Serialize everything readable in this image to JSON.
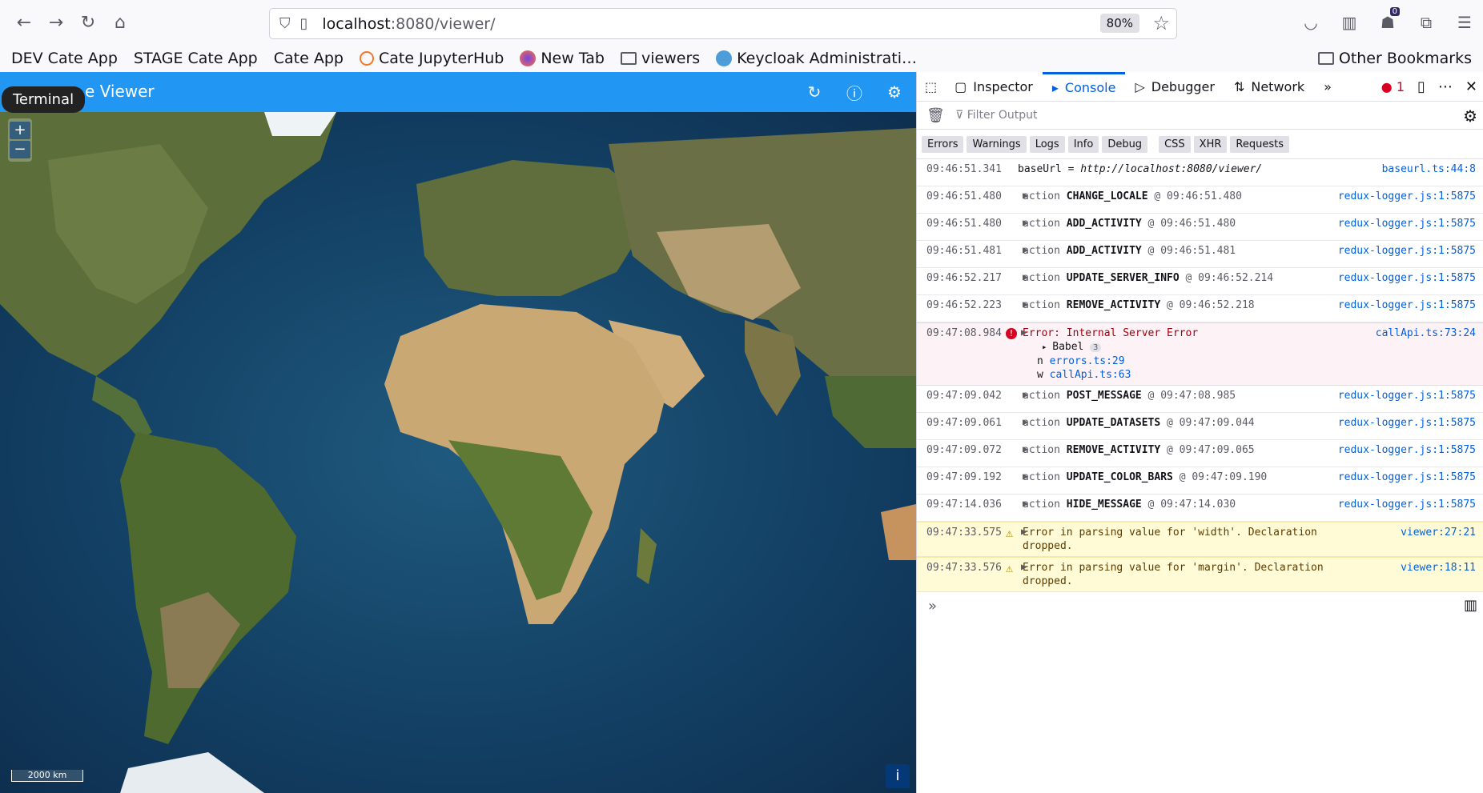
{
  "browser": {
    "url_host": "localhost",
    "url_rest": ":8080/viewer/",
    "zoom": "80%",
    "notification_count": "0"
  },
  "bookmarks": [
    {
      "label": "DEV Cate App",
      "icon": "app-icon"
    },
    {
      "label": "STAGE Cate App",
      "icon": "app-icon"
    },
    {
      "label": "Cate App",
      "icon": "app-icon"
    },
    {
      "label": "Cate JupyterHub",
      "icon": "jupyter-icon"
    },
    {
      "label": "New Tab",
      "icon": "firefox-icon"
    },
    {
      "label": "viewers",
      "icon": "folder-icon"
    },
    {
      "label": "Keycloak Administrati…",
      "icon": "keycloak-icon"
    }
  ],
  "other_bookmarks": "Other Bookmarks",
  "app": {
    "title": "e Viewer",
    "tooltip": "Terminal",
    "zoom_in": "+",
    "zoom_out": "−",
    "scale_label": "2000 km",
    "info": "i"
  },
  "devtools": {
    "tabs": [
      "Inspector",
      "Console",
      "Debugger",
      "Network"
    ],
    "error_count": "1",
    "filter_placeholder": "Filter Output",
    "levels": [
      "Errors",
      "Warnings",
      "Logs",
      "Info",
      "Debug"
    ],
    "net_levels": [
      "CSS",
      "XHR",
      "Requests"
    ],
    "logs": [
      {
        "type": "plain",
        "ts": "09:46:51.341",
        "label": "baseUrl = ",
        "value": "http://localhost:8080/viewer/",
        "src": "baseurl.ts:44:8"
      },
      {
        "type": "action",
        "ts": "09:46:51.480",
        "name": "CHANGE_LOCALE",
        "at": "@ 09:46:51.480",
        "src": "redux-logger.js:1:5875"
      },
      {
        "type": "action",
        "ts": "09:46:51.480",
        "name": "ADD_ACTIVITY",
        "at": "@ 09:46:51.480",
        "src": "redux-logger.js:1:5875"
      },
      {
        "type": "action",
        "ts": "09:46:51.481",
        "name": "ADD_ACTIVITY",
        "at": "@ 09:46:51.481",
        "src": "redux-logger.js:1:5875"
      },
      {
        "type": "action",
        "ts": "09:46:52.217",
        "name": "UPDATE_SERVER_INFO",
        "at": "@ 09:46:52.214",
        "src": "redux-logger.js:1:5875"
      },
      {
        "type": "action",
        "ts": "09:46:52.223",
        "name": "REMOVE_ACTIVITY",
        "at": "@ 09:46:52.218",
        "src": "redux-logger.js:1:5875"
      },
      {
        "type": "error",
        "ts": "09:47:08.984",
        "msg": "Error: Internal Server Error",
        "src": "callApi.ts:73:24",
        "sub": [
          {
            "pre": "Babel",
            "count": "3"
          },
          {
            "pre": "n",
            "link": "errors.ts:29"
          },
          {
            "pre": "w",
            "link": "callApi.ts:63"
          }
        ]
      },
      {
        "type": "action",
        "ts": "09:47:09.042",
        "name": "POST_MESSAGE",
        "at": "@ 09:47:08.985",
        "src": "redux-logger.js:1:5875"
      },
      {
        "type": "action",
        "ts": "09:47:09.061",
        "name": "UPDATE_DATASETS",
        "at": "@ 09:47:09.044",
        "src": "redux-logger.js:1:5875"
      },
      {
        "type": "action",
        "ts": "09:47:09.072",
        "name": "REMOVE_ACTIVITY",
        "at": "@ 09:47:09.065",
        "src": "redux-logger.js:1:5875"
      },
      {
        "type": "action",
        "ts": "09:47:09.192",
        "name": "UPDATE_COLOR_BARS",
        "at": "@ 09:47:09.190",
        "src": "redux-logger.js:1:5875"
      },
      {
        "type": "action",
        "ts": "09:47:14.036",
        "name": "HIDE_MESSAGE",
        "at": "@ 09:47:14.030",
        "src": "redux-logger.js:1:5875"
      },
      {
        "type": "warn",
        "ts": "09:47:33.575",
        "msg": "Error in parsing value for 'width'.  Declaration dropped.",
        "src": "viewer:27:21"
      },
      {
        "type": "warn",
        "ts": "09:47:33.576",
        "msg": "Error in parsing value for 'margin'.  Declaration dropped.",
        "src": "viewer:18:11"
      }
    ],
    "action_word": "action"
  },
  "colors": {
    "accent": "#2196f3",
    "devtools_active": "#0061e0",
    "error": "#d70022"
  }
}
